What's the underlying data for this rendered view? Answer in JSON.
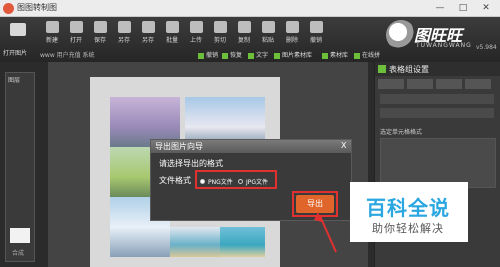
{
  "window": {
    "title": "图图转制图",
    "min": "—",
    "max": "□",
    "close": "✕"
  },
  "toolbar": {
    "open_label": "打开图片",
    "tools": [
      "新建",
      "打开",
      "保存",
      "另存",
      "另存",
      "批量",
      "上传",
      "剪切",
      "复制",
      "粘贴",
      "删除",
      "撤销"
    ],
    "subrow_left": "www 用户充值 系统",
    "subrow": [
      "撤销",
      "恢复",
      "文字",
      "图片素材库",
      "素材库",
      "在线拼"
    ]
  },
  "brand": {
    "name": "图旺旺",
    "en": "TUWANGWANG",
    "version": "v5.984"
  },
  "left_panel": {
    "header": "图层",
    "footer": "合成"
  },
  "right_panel": {
    "title": "表格组设置",
    "tabs": [
      "",
      "",
      "",
      ""
    ],
    "section_label": "选定单元格格式"
  },
  "dialog": {
    "title": "导出图片向导",
    "close": "X",
    "prompt": "请选择导出的格式",
    "format_label": "文件格式",
    "options": [
      "PNG文件",
      "JPG文件"
    ],
    "selected": "PNG文件",
    "export_button": "导出"
  },
  "watermark": {
    "main": "百科全说",
    "sub": "助你轻松解决"
  },
  "colors": {
    "accent": "#e0652a",
    "highlight": "#e03030",
    "brand_blue": "#2aa6e0"
  }
}
